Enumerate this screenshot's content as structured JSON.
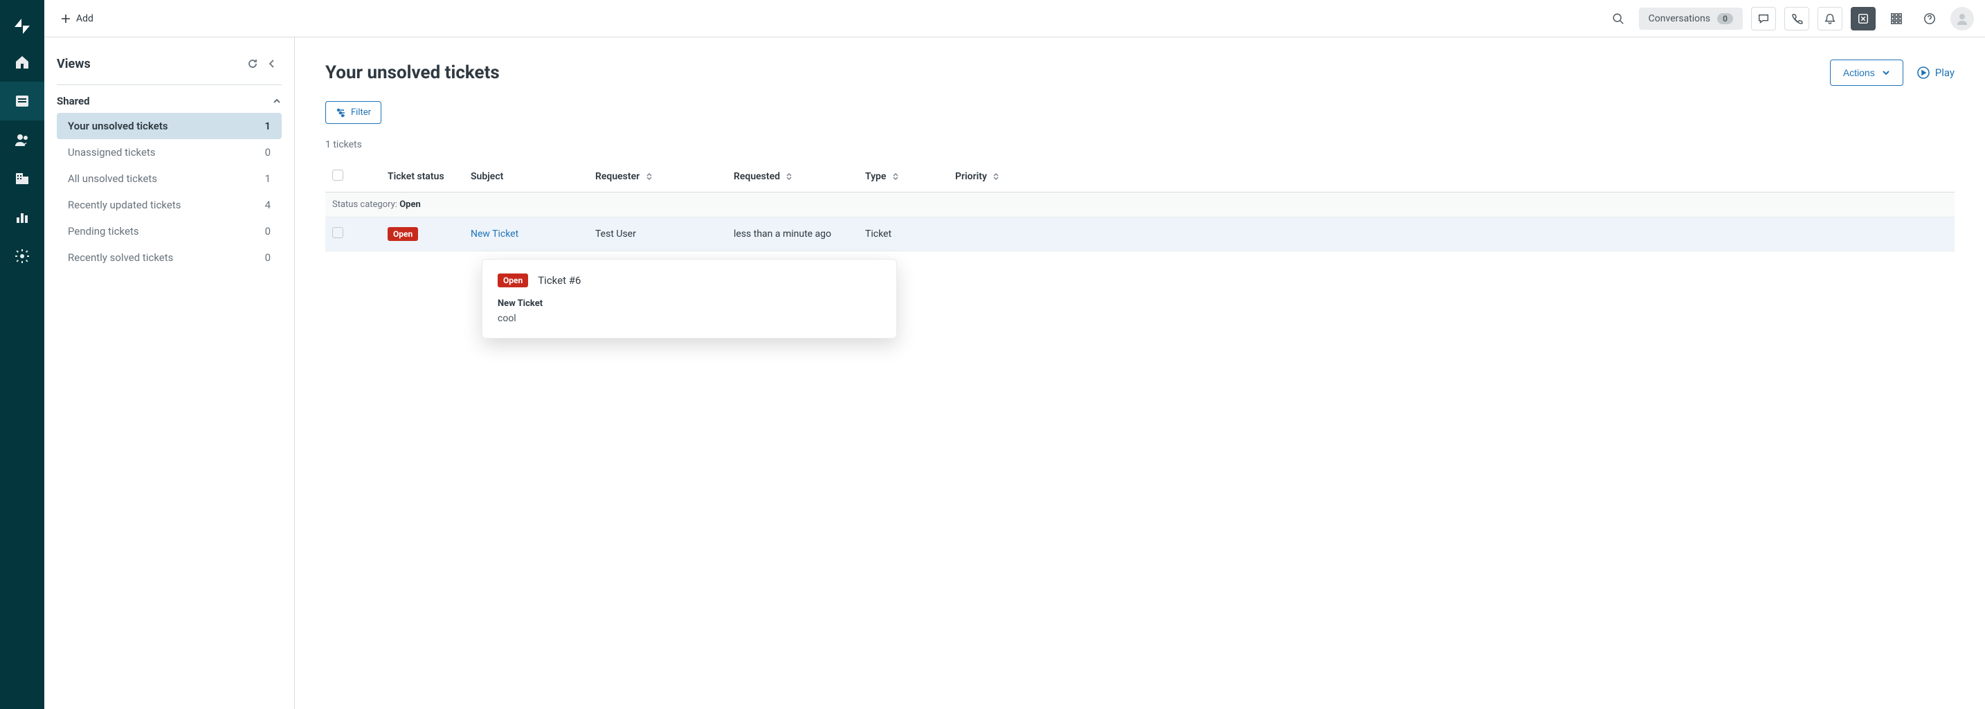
{
  "topbar": {
    "add_label": "Add",
    "conversations_label": "Conversations",
    "conversations_count": "0"
  },
  "views_panel": {
    "title": "Views",
    "section_label": "Shared",
    "items": [
      {
        "label": "Your unsolved tickets",
        "count": "1",
        "selected": true
      },
      {
        "label": "Unassigned tickets",
        "count": "0",
        "selected": false
      },
      {
        "label": "All unsolved tickets",
        "count": "1",
        "selected": false
      },
      {
        "label": "Recently updated tickets",
        "count": "4",
        "selected": false
      },
      {
        "label": "Pending tickets",
        "count": "0",
        "selected": false
      },
      {
        "label": "Recently solved tickets",
        "count": "0",
        "selected": false
      }
    ]
  },
  "main": {
    "title": "Your unsolved tickets",
    "actions_label": "Actions",
    "play_label": "Play",
    "filter_label": "Filter",
    "ticket_count": "1 tickets",
    "columns": {
      "status": "Ticket status",
      "subject": "Subject",
      "requester": "Requester",
      "requested": "Requested",
      "type": "Type",
      "priority": "Priority"
    },
    "group_prefix": "Status category: ",
    "group_value": "Open",
    "rows": [
      {
        "status": "Open",
        "subject": "New Ticket",
        "requester": "Test User",
        "requested": "less than a minute ago",
        "type": "Ticket",
        "priority": ""
      }
    ]
  },
  "tooltip": {
    "status": "Open",
    "title": "Ticket #6",
    "subject": "New Ticket",
    "body": "cool"
  }
}
